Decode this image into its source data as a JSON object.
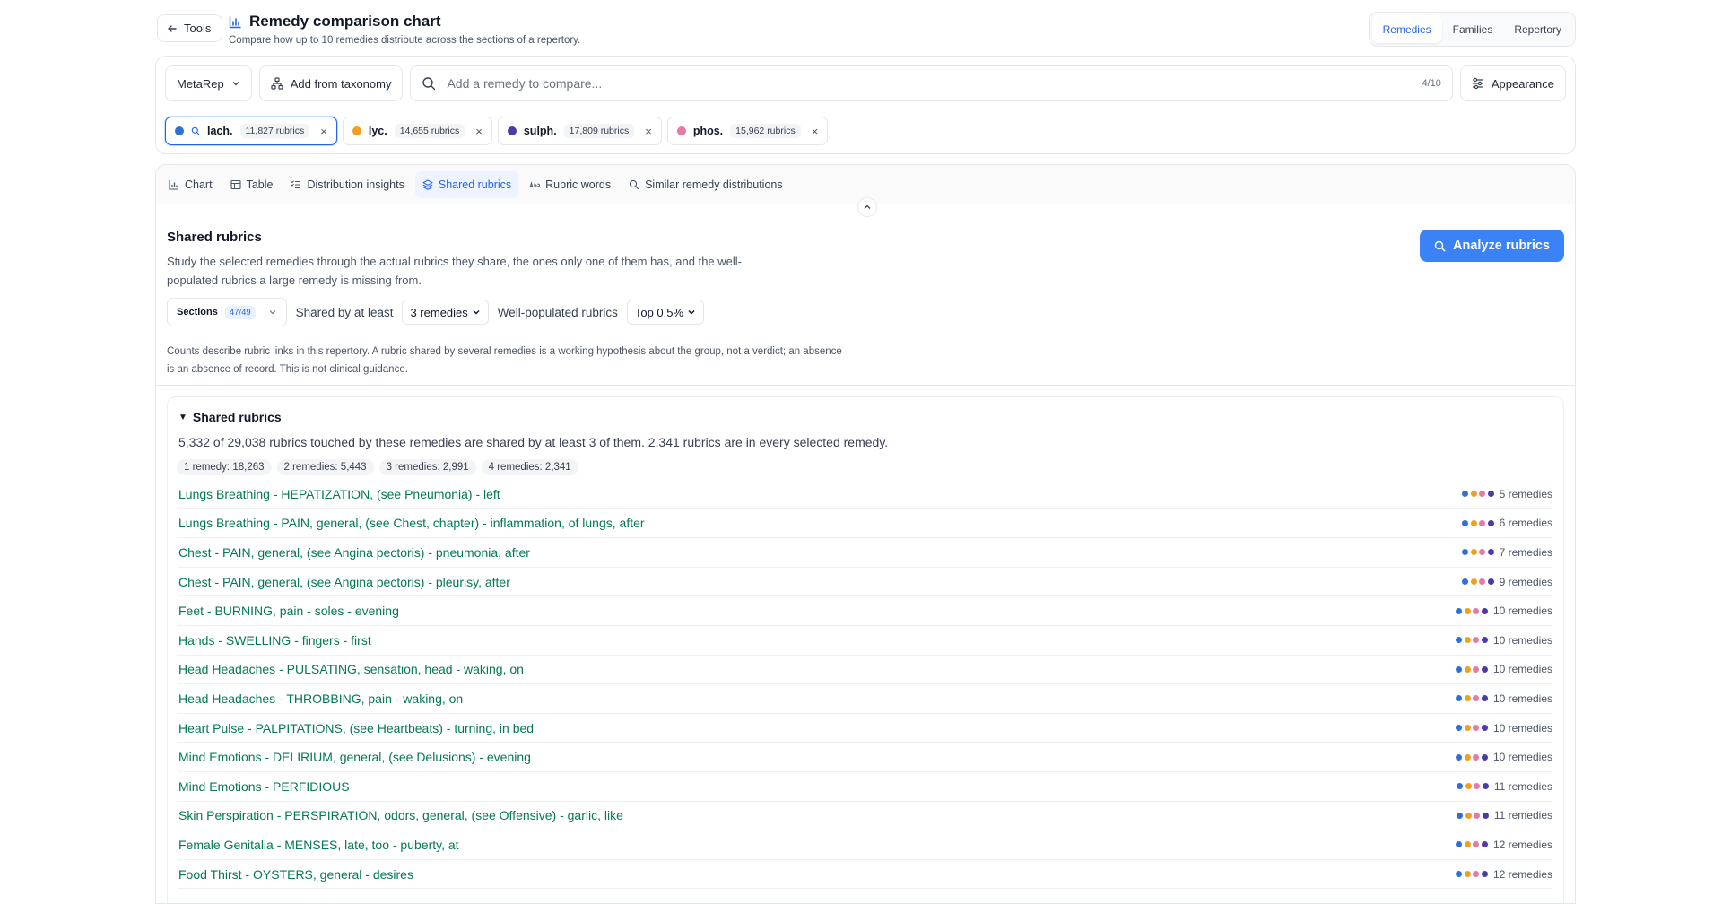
{
  "header": {
    "back_label": "Tools",
    "title": "Remedy comparison chart",
    "subtitle": "Compare how up to 10 remedies distribute across the sections of a repertory.",
    "segments": [
      "Remedies",
      "Families",
      "Repertory"
    ]
  },
  "toolbar": {
    "repertory_label": "MetaRep",
    "taxonomy_label": "Add from taxonomy",
    "search_placeholder": "Add a remedy to compare...",
    "count": "4/10",
    "appearance_label": "Appearance"
  },
  "remedies": [
    {
      "name": "lach.",
      "count": "11,827 rubrics",
      "color": "#2f6fd6"
    },
    {
      "name": "lyc.",
      "count": "14,655 rubrics",
      "color": "#f0a020"
    },
    {
      "name": "sulph.",
      "count": "17,809 rubrics",
      "color": "#4c3aa8"
    },
    {
      "name": "phos.",
      "count": "15,962 rubrics",
      "color": "#e57aa6"
    }
  ],
  "tabs": [
    "Chart",
    "Table",
    "Distribution insights",
    "Shared rubrics",
    "Rubric words",
    "Similar remedy distributions"
  ],
  "section": {
    "title": "Shared rubrics",
    "description": "Study the selected remedies through the actual rubrics they share, the ones only one of them has, and the well-populated rubrics a large remedy is missing from.",
    "analyze_label": "Analyze rubrics",
    "sections_label": "Sections",
    "sections_badge": "47/49",
    "shared_by_label": "Shared by at least",
    "shared_by_value": "3 remedies",
    "well_pop_label": "Well-populated rubrics",
    "well_pop_value": "Top 0.5%",
    "note": "Counts describe rubric links in this repertory. A rubric shared by several remedies is a working hypothesis about the group, not a verdict; an absence is an absence of record. This is not clinical guidance."
  },
  "shared": {
    "title": "Shared rubrics",
    "summary": "5,332 of 29,038 rubrics touched by these remedies are shared by at least 3 of them. 2,341 rubrics are in every selected remedy.",
    "pills": [
      "1 remedy: 18,263",
      "2 remedies: 5,443",
      "3 remedies: 2,991",
      "4 remedies: 2,341"
    ],
    "dot_colors": [
      "#2f6fd6",
      "#f0a020",
      "#e57aa6",
      "#4c3aa8"
    ],
    "rows": [
      {
        "label": "Lungs Breathing - HEPATIZATION, (see Pneumonia) - left",
        "count": "5 remedies"
      },
      {
        "label": "Lungs Breathing - PAIN, general, (see Chest, chapter) - inflammation, of lungs, after",
        "count": "6 remedies"
      },
      {
        "label": "Chest - PAIN, general, (see Angina pectoris) - pneumonia, after",
        "count": "7 remedies"
      },
      {
        "label": "Chest - PAIN, general, (see Angina pectoris) - pleurisy, after",
        "count": "9 remedies"
      },
      {
        "label": "Feet - BURNING, pain - soles - evening",
        "count": "10 remedies"
      },
      {
        "label": "Hands - SWELLING - fingers - first",
        "count": "10 remedies"
      },
      {
        "label": "Head Headaches - PULSATING, sensation, head - waking, on",
        "count": "10 remedies"
      },
      {
        "label": "Head Headaches - THROBBING, pain - waking, on",
        "count": "10 remedies"
      },
      {
        "label": "Heart Pulse - PALPITATIONS, (see Heartbeats) - turning, in bed",
        "count": "10 remedies"
      },
      {
        "label": "Mind Emotions - DELIRIUM, general, (see Delusions) - evening",
        "count": "10 remedies"
      },
      {
        "label": "Mind Emotions - PERFIDIOUS",
        "count": "11 remedies"
      },
      {
        "label": "Skin Perspiration - PERSPIRATION, odors, general, (see Offensive) - garlic, like",
        "count": "11 remedies"
      },
      {
        "label": "Female Genitalia - MENSES, late, too - puberty, at",
        "count": "12 remedies"
      },
      {
        "label": "Food Thirst - OYSTERS, general - desires",
        "count": "12 remedies"
      }
    ]
  }
}
